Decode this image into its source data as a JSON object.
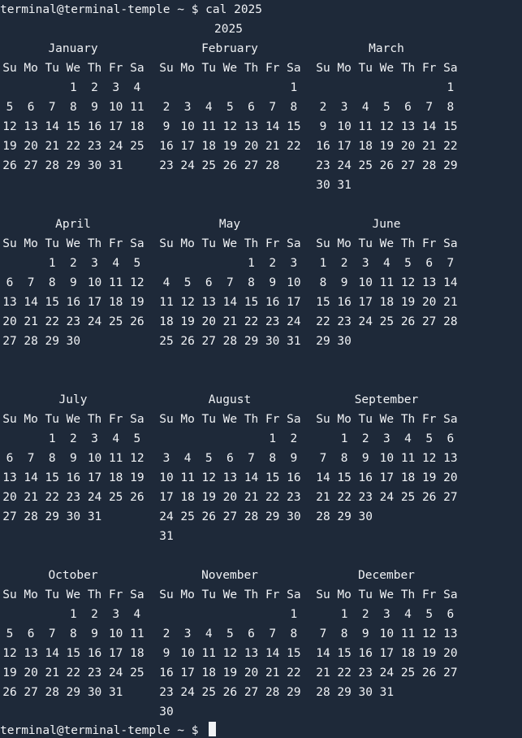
{
  "terminal": {
    "prompt": "terminal@terminal-temple ~ $ ",
    "command": "cal 2025"
  },
  "calendar": {
    "year": "2025",
    "weekdays": [
      "Su",
      "Mo",
      "Tu",
      "We",
      "Th",
      "Fr",
      "Sa"
    ],
    "months": [
      {
        "name": "January",
        "weeks": [
          [
            null,
            null,
            null,
            1,
            2,
            3,
            4
          ],
          [
            5,
            6,
            7,
            8,
            9,
            10,
            11
          ],
          [
            12,
            13,
            14,
            15,
            16,
            17,
            18
          ],
          [
            19,
            20,
            21,
            22,
            23,
            24,
            25
          ],
          [
            26,
            27,
            28,
            29,
            30,
            31,
            null
          ]
        ]
      },
      {
        "name": "February",
        "weeks": [
          [
            null,
            null,
            null,
            null,
            null,
            null,
            1
          ],
          [
            2,
            3,
            4,
            5,
            6,
            7,
            8
          ],
          [
            9,
            10,
            11,
            12,
            13,
            14,
            15
          ],
          [
            16,
            17,
            18,
            19,
            20,
            21,
            22
          ],
          [
            23,
            24,
            25,
            26,
            27,
            28,
            null
          ]
        ]
      },
      {
        "name": "March",
        "weeks": [
          [
            null,
            null,
            null,
            null,
            null,
            null,
            1
          ],
          [
            2,
            3,
            4,
            5,
            6,
            7,
            8
          ],
          [
            9,
            10,
            11,
            12,
            13,
            14,
            15
          ],
          [
            16,
            17,
            18,
            19,
            20,
            21,
            22
          ],
          [
            23,
            24,
            25,
            26,
            27,
            28,
            29
          ],
          [
            30,
            31,
            null,
            null,
            null,
            null,
            null
          ]
        ]
      },
      {
        "name": "April",
        "weeks": [
          [
            null,
            null,
            1,
            2,
            3,
            4,
            5
          ],
          [
            6,
            7,
            8,
            9,
            10,
            11,
            12
          ],
          [
            13,
            14,
            15,
            16,
            17,
            18,
            19
          ],
          [
            20,
            21,
            22,
            23,
            24,
            25,
            26
          ],
          [
            27,
            28,
            29,
            30,
            null,
            null,
            null
          ]
        ]
      },
      {
        "name": "May",
        "weeks": [
          [
            null,
            null,
            null,
            null,
            1,
            2,
            3
          ],
          [
            4,
            5,
            6,
            7,
            8,
            9,
            10
          ],
          [
            11,
            12,
            13,
            14,
            15,
            16,
            17
          ],
          [
            18,
            19,
            20,
            21,
            22,
            23,
            24
          ],
          [
            25,
            26,
            27,
            28,
            29,
            30,
            31
          ]
        ]
      },
      {
        "name": "June",
        "weeks": [
          [
            1,
            2,
            3,
            4,
            5,
            6,
            7
          ],
          [
            8,
            9,
            10,
            11,
            12,
            13,
            14
          ],
          [
            15,
            16,
            17,
            18,
            19,
            20,
            21
          ],
          [
            22,
            23,
            24,
            25,
            26,
            27,
            28
          ],
          [
            29,
            30,
            null,
            null,
            null,
            null,
            null
          ]
        ]
      },
      {
        "name": "July",
        "weeks": [
          [
            null,
            null,
            1,
            2,
            3,
            4,
            5
          ],
          [
            6,
            7,
            8,
            9,
            10,
            11,
            12
          ],
          [
            13,
            14,
            15,
            16,
            17,
            18,
            19
          ],
          [
            20,
            21,
            22,
            23,
            24,
            25,
            26
          ],
          [
            27,
            28,
            29,
            30,
            31,
            null,
            null
          ]
        ]
      },
      {
        "name": "August",
        "weeks": [
          [
            null,
            null,
            null,
            null,
            null,
            1,
            2
          ],
          [
            3,
            4,
            5,
            6,
            7,
            8,
            9
          ],
          [
            10,
            11,
            12,
            13,
            14,
            15,
            16
          ],
          [
            17,
            18,
            19,
            20,
            21,
            22,
            23
          ],
          [
            24,
            25,
            26,
            27,
            28,
            29,
            30
          ],
          [
            31,
            null,
            null,
            null,
            null,
            null,
            null
          ]
        ]
      },
      {
        "name": "September",
        "weeks": [
          [
            null,
            1,
            2,
            3,
            4,
            5,
            6
          ],
          [
            7,
            8,
            9,
            10,
            11,
            12,
            13
          ],
          [
            14,
            15,
            16,
            17,
            18,
            19,
            20
          ],
          [
            21,
            22,
            23,
            24,
            25,
            26,
            27
          ],
          [
            28,
            29,
            30,
            null,
            null,
            null,
            null
          ]
        ]
      },
      {
        "name": "October",
        "weeks": [
          [
            null,
            null,
            null,
            1,
            2,
            3,
            4
          ],
          [
            5,
            6,
            7,
            8,
            9,
            10,
            11
          ],
          [
            12,
            13,
            14,
            15,
            16,
            17,
            18
          ],
          [
            19,
            20,
            21,
            22,
            23,
            24,
            25
          ],
          [
            26,
            27,
            28,
            29,
            30,
            31,
            null
          ]
        ]
      },
      {
        "name": "November",
        "weeks": [
          [
            null,
            null,
            null,
            null,
            null,
            null,
            1
          ],
          [
            2,
            3,
            4,
            5,
            6,
            7,
            8
          ],
          [
            9,
            10,
            11,
            12,
            13,
            14,
            15
          ],
          [
            16,
            17,
            18,
            19,
            20,
            21,
            22
          ],
          [
            23,
            24,
            25,
            26,
            27,
            28,
            29
          ],
          [
            30,
            null,
            null,
            null,
            null,
            null,
            null
          ]
        ]
      },
      {
        "name": "December",
        "weeks": [
          [
            null,
            1,
            2,
            3,
            4,
            5,
            6
          ],
          [
            7,
            8,
            9,
            10,
            11,
            12,
            13
          ],
          [
            14,
            15,
            16,
            17,
            18,
            19,
            20
          ],
          [
            21,
            22,
            23,
            24,
            25,
            26,
            27
          ],
          [
            28,
            29,
            30,
            31,
            null,
            null,
            null
          ]
        ]
      }
    ]
  },
  "prompt_line": {
    "prompt": "terminal@terminal-temple ~ $ ",
    "input_value": ""
  }
}
